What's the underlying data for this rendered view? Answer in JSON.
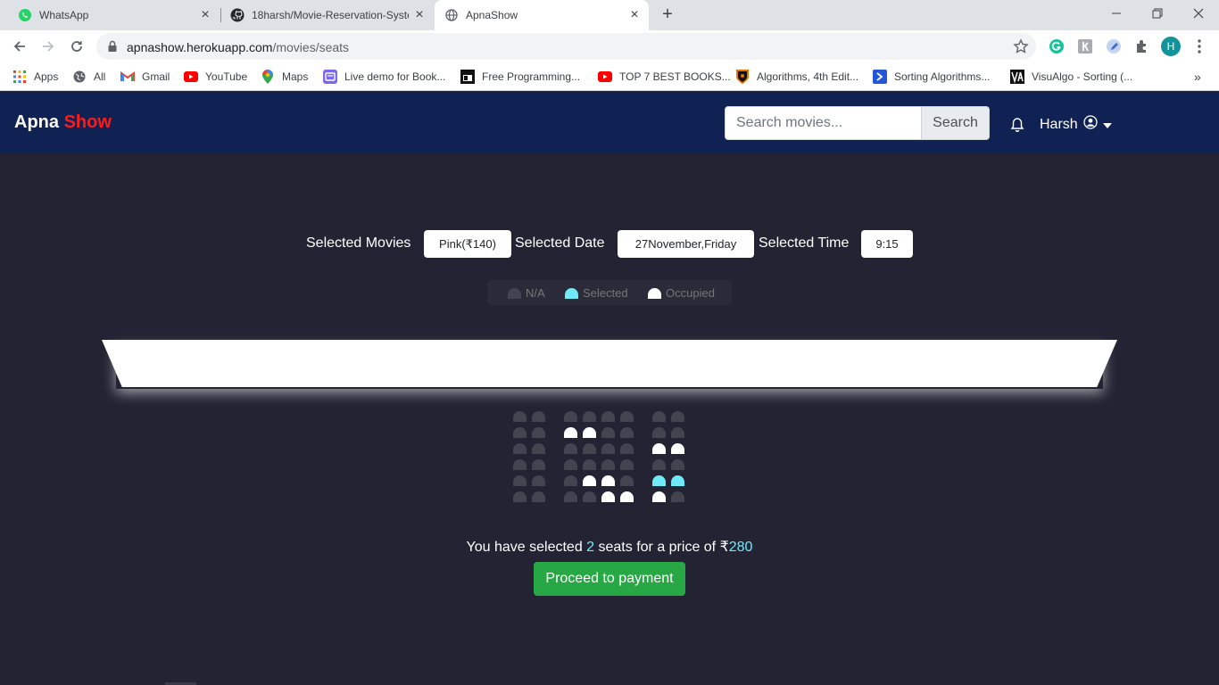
{
  "browser": {
    "tabs": [
      {
        "title": "WhatsApp",
        "icon": "whatsapp-icon"
      },
      {
        "title": "18harsh/Movie-Reservation-Syste",
        "icon": "github-icon"
      },
      {
        "title": "ApnaShow",
        "icon": "globe-icon"
      }
    ],
    "url_host": "apnashow.herokuapp.com",
    "url_path": "/movies/seats",
    "profile_initial": "H",
    "bookmarks": [
      {
        "label": "Apps",
        "icon": "apps-grid-icon"
      },
      {
        "label": "All",
        "icon": "globe-icon"
      },
      {
        "label": "Gmail",
        "icon": "gmail-icon"
      },
      {
        "label": "YouTube",
        "icon": "youtube-icon"
      },
      {
        "label": "Maps",
        "icon": "maps-pin-icon"
      },
      {
        "label": "Live demo for Book...",
        "icon": "book-icon"
      },
      {
        "label": "Free Programming...",
        "icon": "programming-icon"
      },
      {
        "label": "TOP 7 BEST BOOKS...",
        "icon": "youtube-icon"
      },
      {
        "label": "Algorithms, 4th Edit...",
        "icon": "princeton-icon"
      },
      {
        "label": "Sorting Algorithms...",
        "icon": "sorting-icon"
      },
      {
        "label": "VisuAlgo - Sorting (...",
        "icon": "visualgo-icon"
      }
    ]
  },
  "app": {
    "brand_first": "Apna",
    "brand_second": "Show",
    "search_placeholder": "Search movies...",
    "search_button": "Search",
    "user_name": "Harsh"
  },
  "selection": {
    "movie_label": "Selected Movies",
    "movie_value": "Pink(₹140)",
    "date_label": "Selected Date",
    "date_value": "27November,Friday",
    "time_label": "Selected Time",
    "time_value": "9:15"
  },
  "legend": {
    "na": "N/A",
    "selected": "Selected",
    "occupied": "Occupied"
  },
  "seat_map": {
    "rows": [
      "NN NNNN NN",
      "NN OONN NN",
      "NN NNNN OO",
      "NN NNNN NN",
      "NN NOON SS",
      "NN NNOO ON"
    ]
  },
  "summary": {
    "prefix": "You have selected ",
    "count": "2",
    "middle": " seats for a price of ₹",
    "price": "280",
    "button": "Proceed to payment"
  },
  "colors": {
    "nav_bg": "#0f2253",
    "page_bg": "#242333",
    "seat_na": "#444451",
    "seat_selected": "#6feaf6",
    "seat_occupied": "#ffffff",
    "accent_red": "#ff1a1a",
    "pay_green": "#28a745"
  }
}
